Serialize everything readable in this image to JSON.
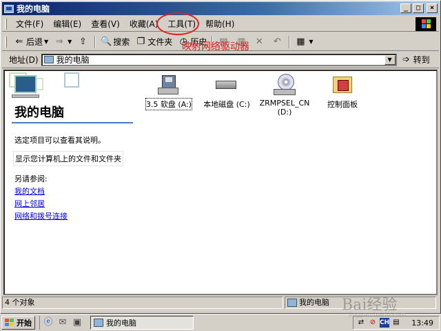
{
  "window": {
    "title": "我的电脑",
    "caption_buttons": [
      "_",
      "□",
      "×"
    ]
  },
  "menubar": {
    "items": [
      "文件(F)",
      "编辑(E)",
      "查看(V)",
      "收藏(A)",
      "工具(T)",
      "帮助(H)"
    ]
  },
  "toolbar": {
    "back_label": "后退",
    "search_label": "搜索",
    "folders_label": "文件夹",
    "history_label": "历史"
  },
  "annotation": {
    "text": "映射网络驱动器",
    "color": "#e02020"
  },
  "addressbar": {
    "label": "地址(D)",
    "value": "我的电脑",
    "go_label": "转到"
  },
  "leftpane": {
    "title": "我的电脑",
    "description": "选定项目可以查看其说明。",
    "hint": "显示您计算机上的文件和文件夹",
    "see_also": "另请参阅:",
    "links": [
      "我的文档",
      "网上邻居",
      "网络和拨号连接"
    ]
  },
  "items": [
    {
      "label": "3.5 软盘 (A:)",
      "icon": "floppy-drive-icon"
    },
    {
      "label": "本地磁盘 (C:)",
      "icon": "hard-disk-icon"
    },
    {
      "label": "ZRMPSEL_CN (D:)",
      "icon": "cd-drive-icon"
    },
    {
      "label": "控制面板",
      "icon": "control-panel-icon"
    }
  ],
  "statusbar": {
    "count": "4 个对象",
    "location": "我的电脑"
  },
  "taskbar": {
    "start_label": "开始",
    "task_label": "我的电脑",
    "ime_label": "CH",
    "clock": "13:49"
  },
  "watermark": {
    "text": "Bai经验",
    "sub": "jingyan.baidu.com"
  },
  "colors": {
    "title_start": "#0a246a",
    "title_end": "#a6caf0",
    "link": "#0000ee",
    "face": "#d4d0c8"
  }
}
